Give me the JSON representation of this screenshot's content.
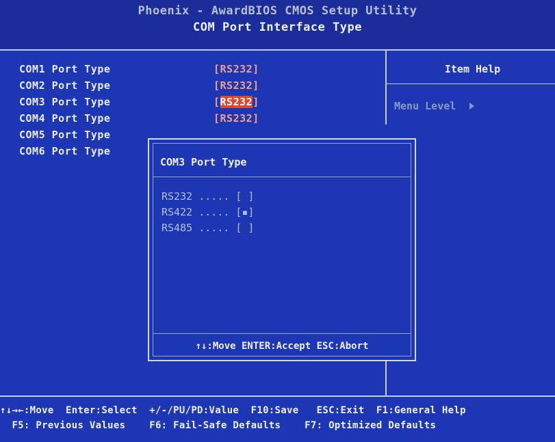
{
  "header": {
    "title": "Phoenix - AwardBIOS CMOS Setup Utility",
    "subtitle": "COM Port Interface Type"
  },
  "settings": [
    {
      "label": "COM1 Port Type",
      "value": "[RS232]"
    },
    {
      "label": "COM2 Port Type",
      "value": "[RS232]"
    },
    {
      "label": "COM3 Port Type",
      "value": "[RS232]"
    },
    {
      "label": "COM4 Port Type",
      "value": "[RS232]"
    },
    {
      "label": "COM5 Port Type",
      "value": ""
    },
    {
      "label": "COM6 Port Type",
      "value": ""
    }
  ],
  "help": {
    "title": "Item Help",
    "menu_level": "Menu Level"
  },
  "popup": {
    "title": "COM3 Port Type",
    "options": [
      {
        "name": "RS232",
        "marker": "[ ]"
      },
      {
        "name": "RS422",
        "marker": "[▪]"
      },
      {
        "name": "RS485",
        "marker": "[ ]"
      }
    ],
    "hint": "↑↓:Move ENTER:Accept ESC:Abort"
  },
  "footer": {
    "line1": "↑↓→←:Move  Enter:Select  +/-/PU/PD:Value  F10:Save   ESC:Exit  F1:General Help",
    "line2": "  F5: Previous Values    F6: Fail-Safe Defaults    F7: Optimized Defaults"
  },
  "colors": {
    "background": "#1d36b4",
    "highlight": "#e0462a",
    "value_text": "#f0a08a"
  }
}
